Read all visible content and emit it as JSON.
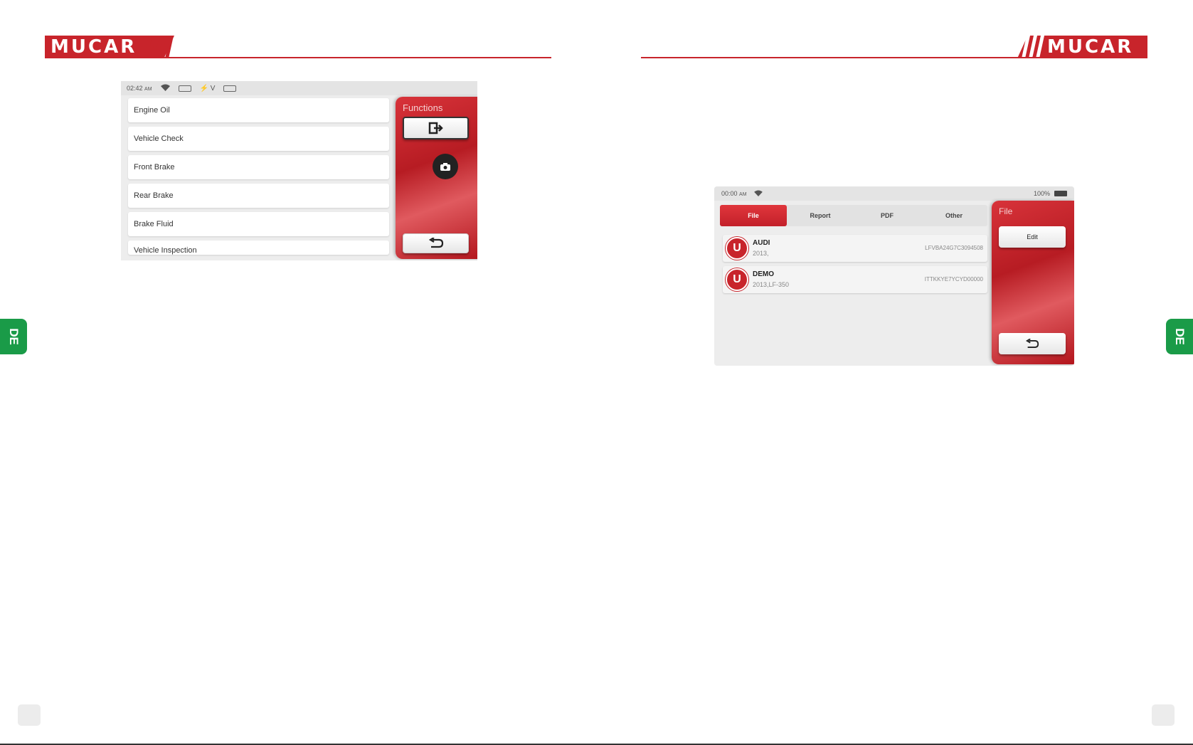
{
  "header": {
    "brand": "MUCAR",
    "brand_color": "#c8242b"
  },
  "side_tab": {
    "label": "DE",
    "color": "#1a9b48"
  },
  "screen1": {
    "status": {
      "time": "02:42",
      "ampm": "AM",
      "voltage": "V"
    },
    "items": [
      "Engine Oil",
      "Vehicle Check",
      "Front Brake",
      "Rear Brake",
      "Brake Fluid",
      "Vehicle Inspection"
    ],
    "panel": {
      "title": "Functions",
      "exit_icon": "exit-icon",
      "camera_icon": "camera-icon",
      "back_icon": "back-icon"
    }
  },
  "screen2": {
    "status": {
      "time": "00:00",
      "ampm": "AM",
      "battery": "100%"
    },
    "tabs": [
      "File",
      "Report",
      "PDF",
      "Other"
    ],
    "active_tab": "File",
    "records": [
      {
        "make": "AUDI",
        "year": "2013,",
        "vin": "LFVBA24G7C3094508"
      },
      {
        "make": "DEMO",
        "year": "2013,LF-350",
        "vin": "ITTKKYE7YCYD00000"
      }
    ],
    "panel": {
      "title": "File",
      "edit_label": "Edit",
      "back_icon": "back-icon"
    }
  }
}
